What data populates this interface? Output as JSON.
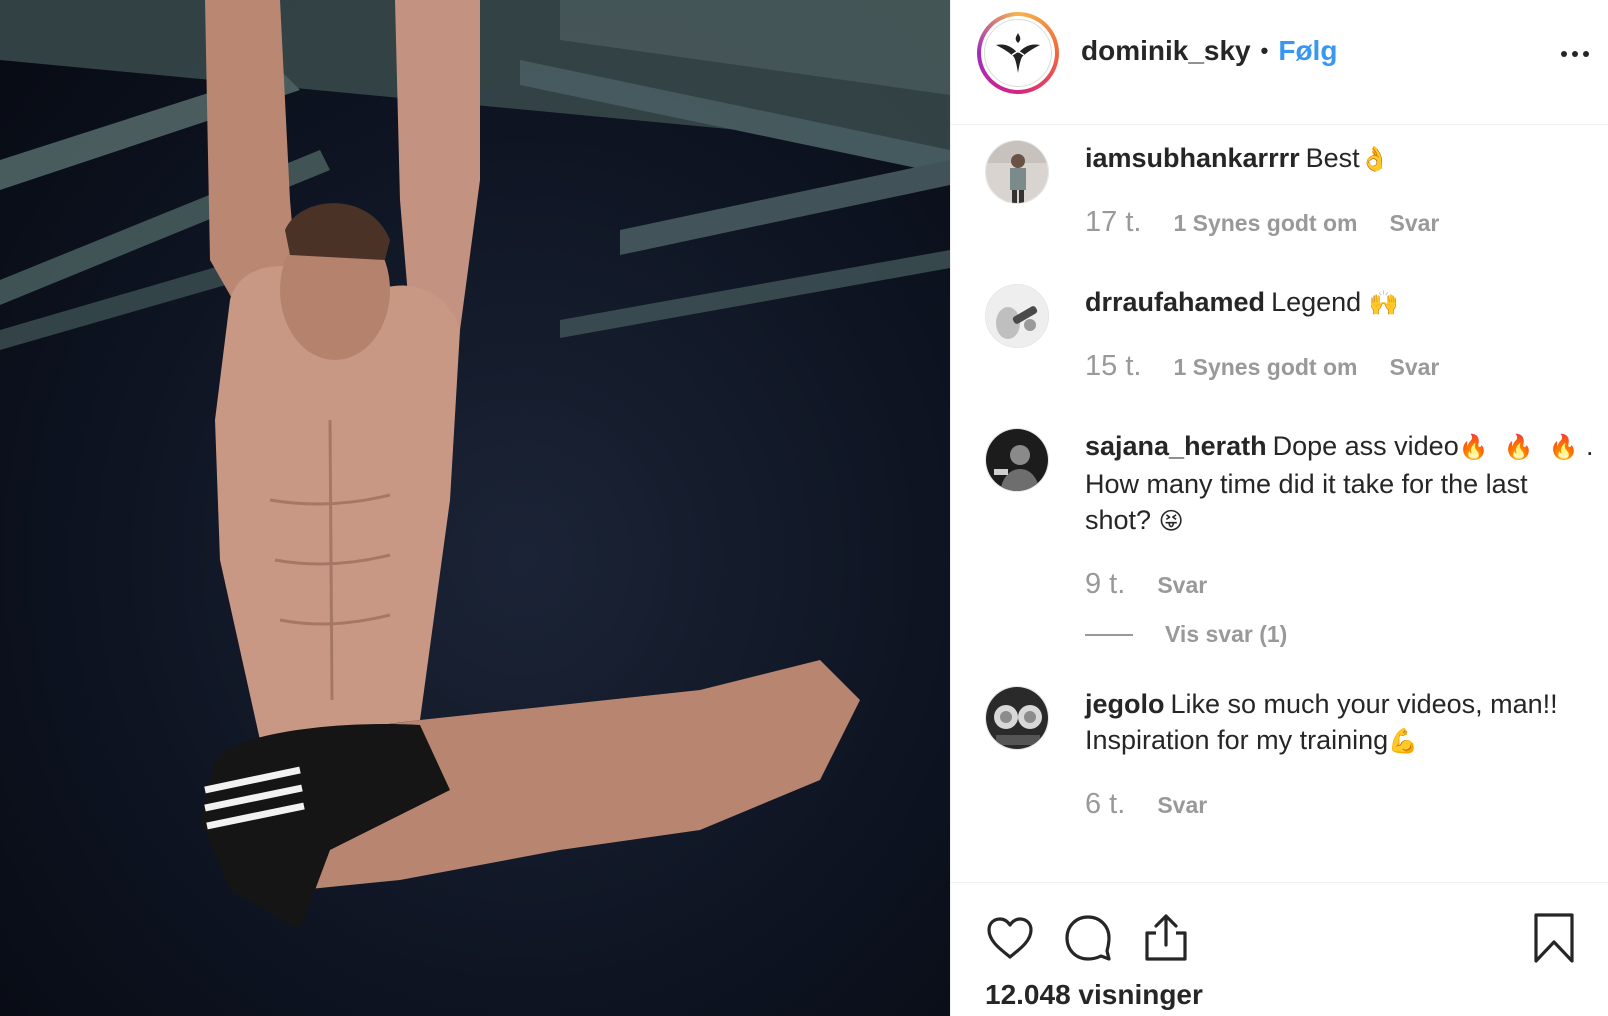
{
  "post": {
    "owner_username": "dominik_sky",
    "separator": "•",
    "follow_label": "Følg",
    "more_icon": "more-options-icon"
  },
  "comments": [
    {
      "username": "iamsubhankarrrr",
      "text": "Best",
      "emoji": "👌",
      "time": "17 t.",
      "likes": "1 Synes godt om",
      "reply_label": "Svar"
    },
    {
      "username": "drraufahamed",
      "text": "Legend",
      "emoji": "🙌",
      "time": "15 t.",
      "likes": "1 Synes godt om",
      "reply_label": "Svar"
    },
    {
      "username": "sajana_herath",
      "text_part1": "Dope ass video",
      "emoji_fire": "🔥",
      "text_part2": ". How many time did it take for the last shot?",
      "emoji_end": "😝",
      "time": "9 t.",
      "reply_label": "Svar",
      "view_replies": "Vis svar (1)"
    },
    {
      "username": "jegolo",
      "text": "Like so much your videos, man!! Inspiration for my training",
      "emoji": "💪",
      "time": "6 t.",
      "reply_label": "Svar"
    }
  ],
  "actions": {
    "like_icon": "heart-icon",
    "comment_icon": "comment-icon",
    "share_icon": "share-icon",
    "save_icon": "bookmark-icon"
  },
  "views_text": "12.048 visninger",
  "colors": {
    "link_blue": "#3897f0",
    "muted_gray": "#999999",
    "text": "#262626",
    "divider": "#efefef"
  }
}
